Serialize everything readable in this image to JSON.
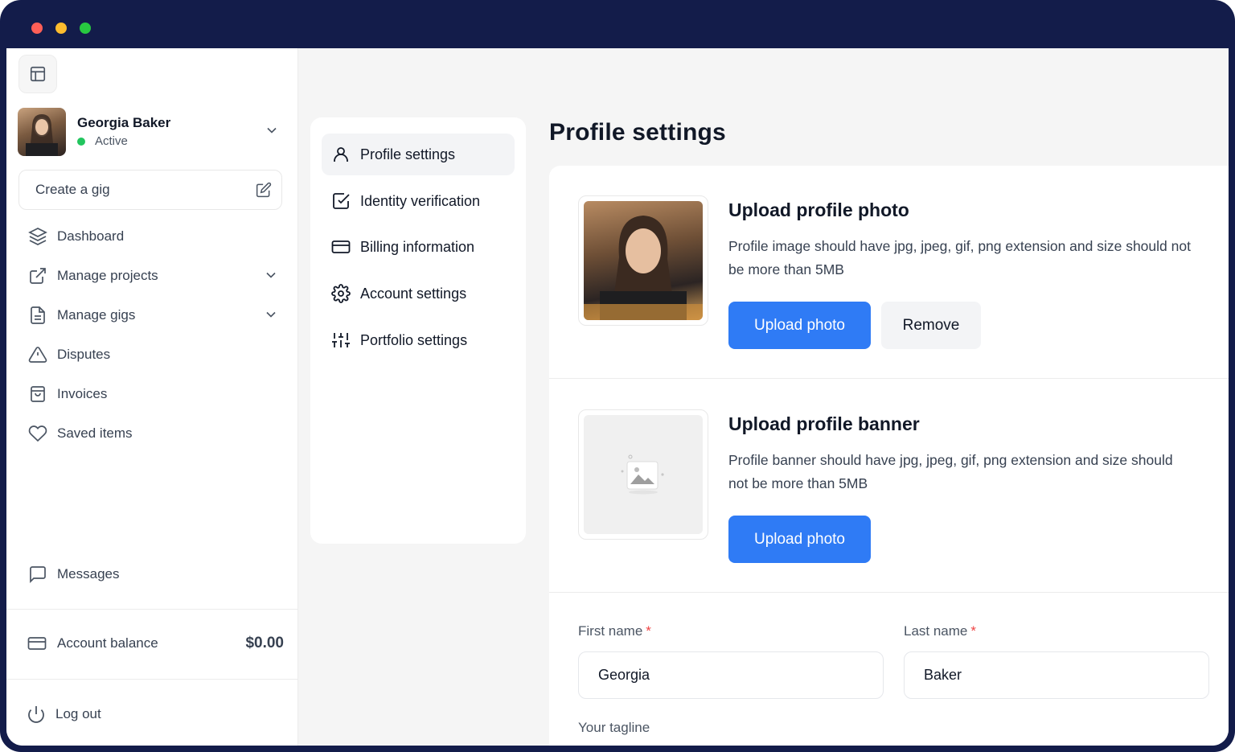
{
  "sidebar": {
    "user": {
      "name": "Georgia Baker",
      "status": "Active"
    },
    "create_gig": "Create a gig",
    "nav": [
      {
        "label": "Dashboard",
        "icon": "layers-icon"
      },
      {
        "label": "Manage projects",
        "icon": "external-link-icon",
        "expandable": true
      },
      {
        "label": "Manage gigs",
        "icon": "document-icon",
        "expandable": true
      },
      {
        "label": "Disputes",
        "icon": "warning-icon"
      },
      {
        "label": "Invoices",
        "icon": "shopping-bag-icon"
      },
      {
        "label": "Saved items",
        "icon": "heart-icon"
      }
    ],
    "messages": "Messages",
    "account_balance": {
      "label": "Account balance",
      "amount": "$0.00"
    },
    "logout": "Log out"
  },
  "settings_nav": {
    "items": [
      {
        "label": "Profile settings",
        "icon": "user-icon",
        "active": true
      },
      {
        "label": "Identity verification",
        "icon": "checkbox-icon"
      },
      {
        "label": "Billing information",
        "icon": "credit-card-icon"
      },
      {
        "label": "Account settings",
        "icon": "gear-icon"
      },
      {
        "label": "Portfolio settings",
        "icon": "sliders-icon"
      }
    ]
  },
  "main": {
    "title": "Profile settings",
    "profile_photo": {
      "title": "Upload profile photo",
      "description": "Profile image should have jpg, jpeg, gif, png extension and size should not be more than 5MB",
      "upload_label": "Upload photo",
      "remove_label": "Remove"
    },
    "profile_banner": {
      "title": "Upload profile banner",
      "description": "Profile banner should have jpg, jpeg, gif, png extension and size should not be more than 5MB",
      "upload_label": "Upload photo"
    },
    "form": {
      "first_name": {
        "label": "First name",
        "value": "Georgia",
        "required_mark": "*"
      },
      "last_name": {
        "label": "Last name",
        "value": "Baker",
        "required_mark": "*"
      },
      "tagline_label": "Your tagline"
    }
  },
  "colors": {
    "accent": "#2f7bf5",
    "status_active": "#22c55e",
    "frame": "#131c4a",
    "required": "#ef4444"
  }
}
